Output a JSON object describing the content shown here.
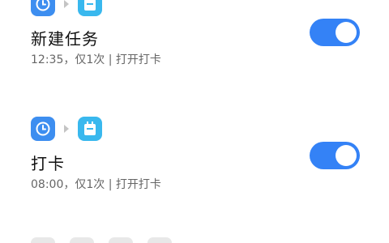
{
  "tasks": [
    {
      "title": "新建任务",
      "description": "12:35，仅1次 | 打开打卡",
      "enabled": true,
      "trigger_icon": "clock-icon",
      "action_icon": "note-icon",
      "colors": {
        "trigger": "#3d8ef0",
        "action": "#39b8ee",
        "toggle_on": "#3482f6"
      }
    },
    {
      "title": "打卡",
      "description": "08:00，仅1次 | 打开打卡",
      "enabled": true,
      "trigger_icon": "clock-icon",
      "action_icon": "note-icon",
      "colors": {
        "trigger": "#3d8ef0",
        "action": "#39b8ee",
        "toggle_on": "#3482f6"
      }
    }
  ]
}
